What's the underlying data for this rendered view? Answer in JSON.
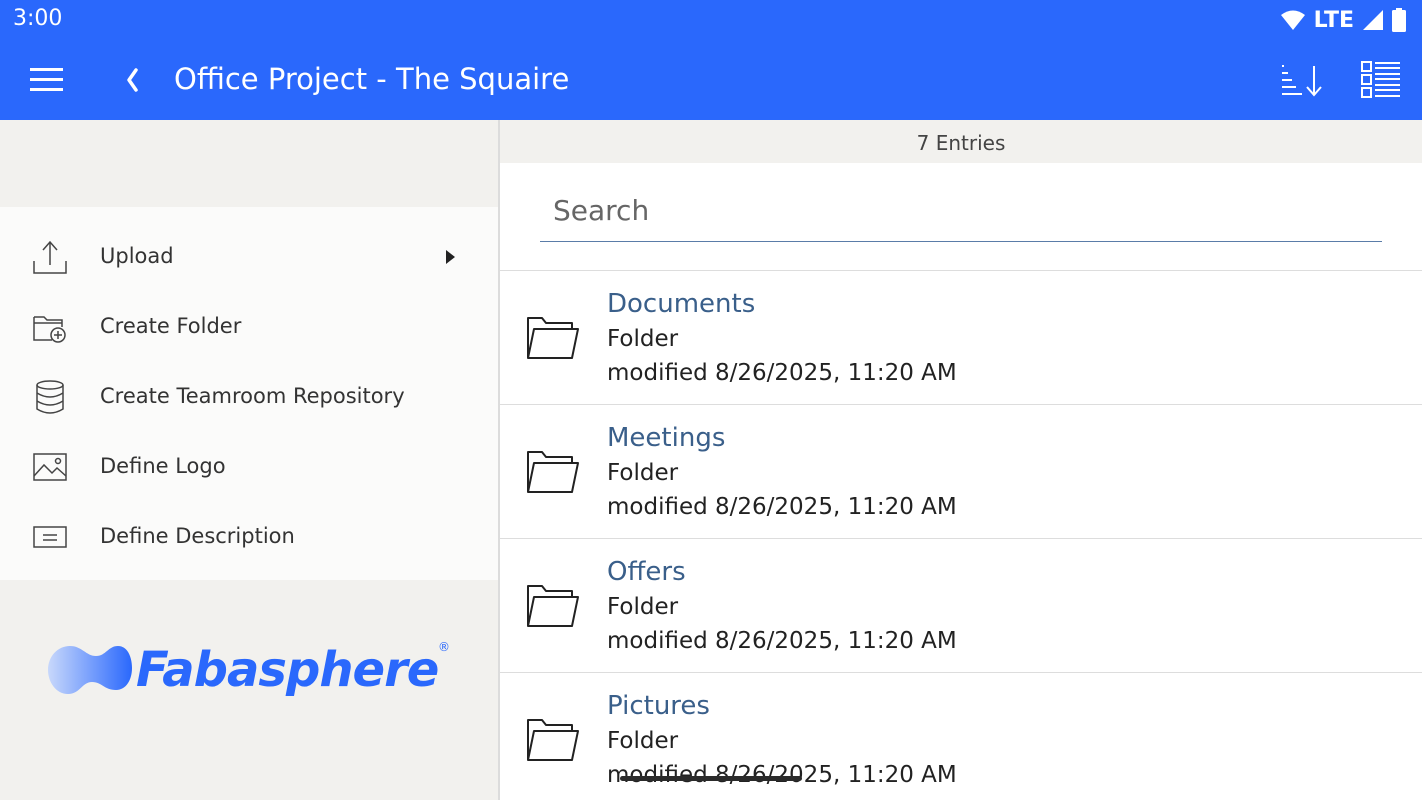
{
  "status_bar": {
    "time": "3:00",
    "network": "LTE"
  },
  "app_bar": {
    "title": "Office Project - The Squaire",
    "menu_icon": "hamburger-menu-icon",
    "back_icon": "chevron-left-icon",
    "sort_icon": "sort-descending-icon",
    "view_icon": "list-view-icon"
  },
  "left_menu": {
    "items": [
      {
        "label": "Upload",
        "icon": "upload-icon",
        "has_submenu": true
      },
      {
        "label": "Create Folder",
        "icon": "folder-add-icon"
      },
      {
        "label": "Create Teamroom Repository",
        "icon": "database-icon"
      },
      {
        "label": "Define Logo",
        "icon": "image-icon"
      },
      {
        "label": "Define Description",
        "icon": "description-icon"
      }
    ]
  },
  "logo": {
    "text": "Fabasphere",
    "mark": "®"
  },
  "content": {
    "entries_count": "7 Entries",
    "search_placeholder": "Search",
    "items": [
      {
        "name": "Documents",
        "type": "Folder",
        "modified": "modified 8/26/2025, 11:20 AM"
      },
      {
        "name": "Meetings",
        "type": "Folder",
        "modified": "modified 8/26/2025, 11:20 AM"
      },
      {
        "name": "Offers",
        "type": "Folder",
        "modified": "modified 8/26/2025, 11:20 AM"
      },
      {
        "name": "Pictures",
        "type": "Folder",
        "modified": "modified 8/26/2025, 11:20 AM"
      }
    ]
  },
  "colors": {
    "accent": "#2a68fc",
    "item_title": "#3a5f8a",
    "panel_bg": "#f2f1ee"
  }
}
